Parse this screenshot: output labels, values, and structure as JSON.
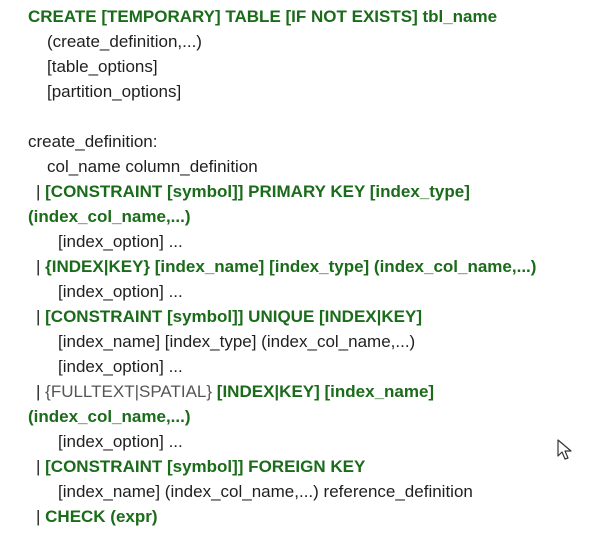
{
  "doc": {
    "line01": "CREATE [TEMPORARY] TABLE [IF NOT EXISTS] tbl_name",
    "line02": "(create_definition,...)",
    "line03": "[table_options]",
    "line04": "[partition_options]",
    "line05": "create_definition:",
    "line06": "col_name column_definition",
    "line07_bar": "| ",
    "line07_green": "[CONSTRAINT [symbol]] PRIMARY KEY [index_type]",
    "line08": "(index_col_name,...)",
    "line09": "[index_option] ...",
    "line10_bar": "| ",
    "line10_green": "{INDEX|KEY} [index_name] [index_type] (index_col_name,...)",
    "line11": "[index_option] ...",
    "line12_bar": "| ",
    "line12_green": "[CONSTRAINT [symbol]] UNIQUE [INDEX|KEY]",
    "line13": "[index_name] [index_type] (index_col_name,...)",
    "line14": "[index_option] ...",
    "line15_bar": "| ",
    "line15_gray": "{FULLTEXT|SPATIAL} ",
    "line15_green": "[INDEX|KEY] [index_name]",
    "line16": "(index_col_name,...)",
    "line17": "[index_option] ...",
    "line18_bar": "| ",
    "line18_green": "[CONSTRAINT [symbol]] FOREIGN KEY",
    "line19": "[index_name] (index_col_name,...) reference_definition",
    "line20_bar": "| ",
    "line20_green": "CHECK (expr)"
  },
  "colors": {
    "keyword": "#1a6b1a",
    "text": "#1f1f1f",
    "muted": "#555555",
    "background": "#ffffff"
  },
  "icons": {
    "cursor": "mouse-pointer-icon"
  }
}
